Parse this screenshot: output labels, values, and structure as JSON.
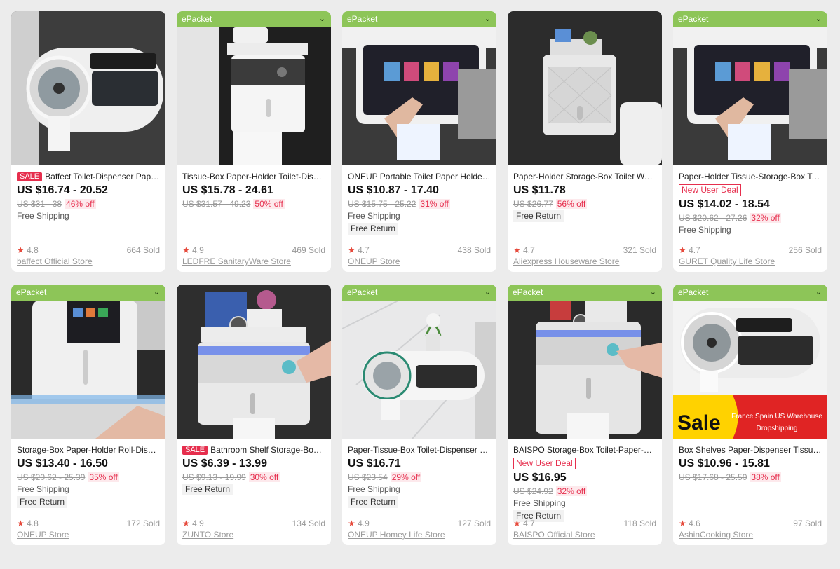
{
  "colors": {
    "ribbon": "#8dc558",
    "sale": "#e62e4d",
    "star": "#e64a3c"
  },
  "products": [
    {
      "ribbon": "",
      "sale": "SALE",
      "new_user": "",
      "title": "Baffect Toilet-Dispenser Paper-Holder Storage-Box",
      "price": "US $16.74 - 20.52",
      "original": "US $31 - 38",
      "discount": "46% off",
      "shipping": "Free Shipping",
      "free_return": "",
      "rating": "4.8",
      "sold": "664 Sold",
      "store": "baffect Official Store"
    },
    {
      "ribbon": "ePacket",
      "sale": "",
      "new_user": "",
      "title": "Tissue-Box Paper-Holder Toilet-Dispenser Storage",
      "price": "US $15.78 - 24.61",
      "original": "US $31.57 - 49.23",
      "discount": "50% off",
      "shipping": "",
      "free_return": "",
      "rating": "4.9",
      "sold": "469 Sold",
      "store": "LEDFRE SanitaryWare Store"
    },
    {
      "ribbon": "ePacket",
      "sale": "",
      "new_user": "",
      "title": "ONEUP Portable Toilet Paper Holder Storage",
      "price": "US $10.87 - 17.40",
      "original": "US $15.75 - 25.22",
      "discount": "31% off",
      "shipping": "Free Shipping",
      "free_return": "Free Return",
      "rating": "4.7",
      "sold": "438 Sold",
      "store": "ONEUP Store"
    },
    {
      "ribbon": "",
      "sale": "",
      "new_user": "",
      "title": "Paper-Holder Storage-Box Toilet Wall-Mounted",
      "price": "US $11.78",
      "original": "US $26.77",
      "discount": "56% off",
      "shipping": "",
      "free_return": "Free Return",
      "rating": "4.7",
      "sold": "321 Sold",
      "store": "Aliexpress Houseware Store"
    },
    {
      "ribbon": "ePacket",
      "sale": "",
      "new_user": "New User Deal",
      "title": "Paper-Holder Tissue-Storage-Box Toilet",
      "price": "US $14.02 - 18.54",
      "original": "US $20.62 - 27.26",
      "discount": "32% off",
      "shipping": "Free Shipping",
      "free_return": "",
      "rating": "4.7",
      "sold": "256 Sold",
      "store": "GURET Quality Life Store"
    },
    {
      "ribbon": "ePacket",
      "sale": "",
      "new_user": "",
      "title": "Storage-Box Paper-Holder Roll-Dispenser Toilet",
      "price": "US $13.40 - 16.50",
      "original": "US $20.62 - 25.39",
      "discount": "35% off",
      "shipping": "Free Shipping",
      "free_return": "Free Return",
      "rating": "4.8",
      "sold": "172 Sold",
      "store": "ONEUP Store"
    },
    {
      "ribbon": "",
      "sale": "SALE",
      "new_user": "",
      "title": "Bathroom Shelf Storage-Box Paper-Holder",
      "price": "US $6.39 - 13.99",
      "original": "US $9.13 - 19.99",
      "discount": "30% off",
      "shipping": "",
      "free_return": "Free Return",
      "rating": "4.9",
      "sold": "134 Sold",
      "store": "ZUNTO Store"
    },
    {
      "ribbon": "ePacket",
      "sale": "",
      "new_user": "",
      "title": "Paper-Tissue-Box Toilet-Dispenser Holder",
      "price": "US $16.71",
      "original": "US $23.54",
      "discount": "29% off",
      "shipping": "Free Shipping",
      "free_return": "Free Return",
      "rating": "4.9",
      "sold": "127 Sold",
      "store": "ONEUP Homey Life Store"
    },
    {
      "ribbon": "ePacket",
      "sale": "",
      "new_user": "New User Deal",
      "title": "BAISPO Storage-Box Toilet-Paper-Holder",
      "price": "US $16.95",
      "original": "US $24.92",
      "discount": "32% off",
      "shipping": "Free Shipping",
      "free_return": "Free Return",
      "rating": "4.7",
      "sold": "118 Sold",
      "store": "BAISPO Official Store"
    },
    {
      "ribbon": "ePacket",
      "sale": "",
      "new_user": "",
      "title": "Box Shelves Paper-Dispenser Tissue-Holder",
      "price": "US $10.96 - 15.81",
      "original": "US $17.68 - 25.50",
      "discount": "38% off",
      "shipping": "",
      "free_return": "",
      "rating": "4.6",
      "sold": "97 Sold",
      "store": "AshinCooking Store",
      "banner_big": "Sale",
      "banner_small": "France Spain US Warehouse Dropshipping"
    }
  ],
  "ui": {
    "star_glyph": "★",
    "chevron_glyph": "⌄"
  }
}
